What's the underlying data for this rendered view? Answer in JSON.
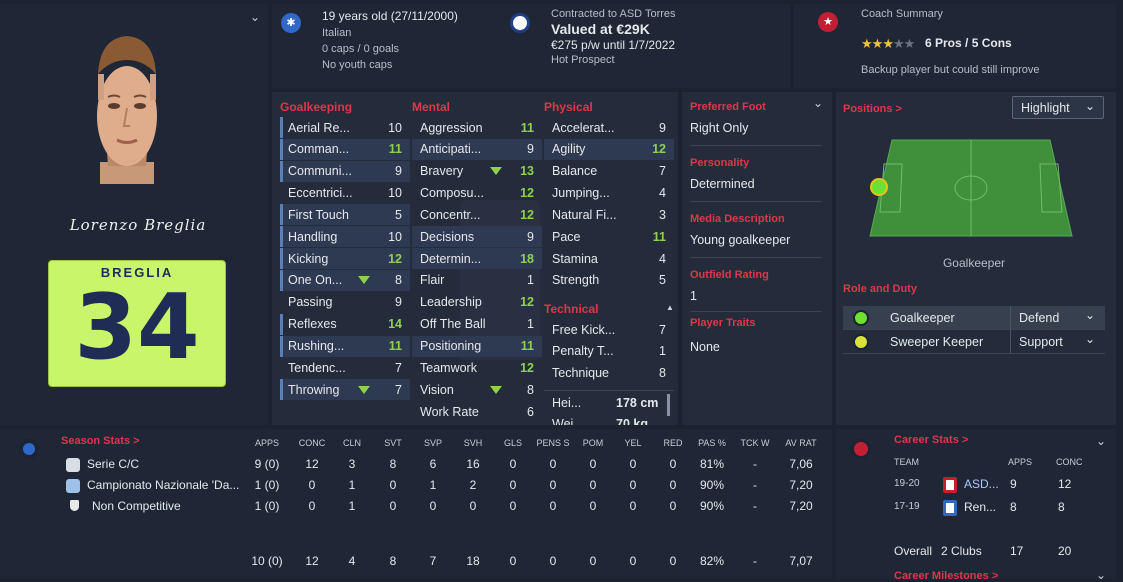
{
  "player": {
    "name_signature": "Lorenzo Breglia",
    "shirt_name": "BREGLIA",
    "shirt_number": "34",
    "age_line": "19 years old (27/11/2000)",
    "nationality": "Italian",
    "caps": "0 caps / 0 goals",
    "youth_caps": "No youth caps"
  },
  "contract": {
    "line1": "Contracted to ASD Torres",
    "value": "Valued at €29K",
    "wage": "€275 p/w until 1/7/2022",
    "tag": "Hot Prospect"
  },
  "coach": {
    "title": "Coach Summary",
    "stars_full": 3,
    "stars_total": 5,
    "pros_cons": "6 Pros / 5 Cons",
    "summary": "Backup player but could still improve"
  },
  "goalkeeping": {
    "header": "Goalkeeping",
    "items": [
      {
        "label": "Aerial Re...",
        "value": "10"
      },
      {
        "label": "Comman...",
        "value": "11"
      },
      {
        "label": "Communi...",
        "value": "9"
      },
      {
        "label": "Eccentrici...",
        "value": "10"
      },
      {
        "label": "First Touch",
        "value": "5"
      },
      {
        "label": "Handling",
        "value": "10"
      },
      {
        "label": "Kicking",
        "value": "12"
      },
      {
        "label": "One On...",
        "value": "8"
      },
      {
        "label": "Passing",
        "value": "9"
      },
      {
        "label": "Reflexes",
        "value": "14"
      },
      {
        "label": "Rushing...",
        "value": "11"
      },
      {
        "label": "Tendenc...",
        "value": "7"
      },
      {
        "label": "Throwing",
        "value": "7"
      }
    ]
  },
  "mental": {
    "header": "Mental",
    "items": [
      {
        "label": "Aggression",
        "value": "11"
      },
      {
        "label": "Anticipati...",
        "value": "9"
      },
      {
        "label": "Bravery",
        "value": "13"
      },
      {
        "label": "Composu...",
        "value": "12"
      },
      {
        "label": "Concentr...",
        "value": "12"
      },
      {
        "label": "Decisions",
        "value": "9"
      },
      {
        "label": "Determin...",
        "value": "18"
      },
      {
        "label": "Flair",
        "value": "1"
      },
      {
        "label": "Leadership",
        "value": "12"
      },
      {
        "label": "Off The Ball",
        "value": "1"
      },
      {
        "label": "Positioning",
        "value": "11"
      },
      {
        "label": "Teamwork",
        "value": "12"
      },
      {
        "label": "Vision",
        "value": "8"
      },
      {
        "label": "Work Rate",
        "value": "6"
      }
    ]
  },
  "physical": {
    "header": "Physical",
    "items": [
      {
        "label": "Accelerat...",
        "value": "9"
      },
      {
        "label": "Agility",
        "value": "12"
      },
      {
        "label": "Balance",
        "value": "7"
      },
      {
        "label": "Jumping...",
        "value": "4"
      },
      {
        "label": "Natural Fi...",
        "value": "3"
      },
      {
        "label": "Pace",
        "value": "11"
      },
      {
        "label": "Stamina",
        "value": "4"
      },
      {
        "label": "Strength",
        "value": "5"
      }
    ]
  },
  "technical": {
    "header": "Technical",
    "items": [
      {
        "label": "Free Kick...",
        "value": "7"
      },
      {
        "label": "Penalty T...",
        "value": "1"
      },
      {
        "label": "Technique",
        "value": "8"
      }
    ]
  },
  "physique": {
    "height_label": "Hei...",
    "height": "178 cm",
    "weight_label": "Wei...",
    "weight": "70 kg"
  },
  "info": {
    "foot_h": "Preferred Foot",
    "foot": "Right Only",
    "pers_h": "Personality",
    "pers": "Determined",
    "media_h": "Media Description",
    "media": "Young goalkeeper",
    "outfield_h": "Outfield Rating",
    "outfield": "1",
    "traits_h": "Player Traits",
    "traits": "None"
  },
  "positions": {
    "title": "Positions >",
    "highlight": "Highlight",
    "pitch_label": "Goalkeeper",
    "role_title": "Role and Duty",
    "roles": [
      {
        "role": "Goalkeeper",
        "duty": "Defend",
        "color": "#6fe031"
      },
      {
        "role": "Sweeper Keeper",
        "duty": "Support",
        "color": "#d8e23a"
      }
    ]
  },
  "season": {
    "title": "Season Stats >",
    "headers": [
      "APPS",
      "CONC",
      "CLN",
      "SVT",
      "SVP",
      "SVH",
      "GLS",
      "PENS S",
      "POM",
      "YEL",
      "RED",
      "PAS %",
      "TCK W",
      "AV RAT"
    ],
    "rows": [
      {
        "comp": "Serie C/C",
        "cells": [
          "9 (0)",
          "12",
          "3",
          "8",
          "6",
          "16",
          "0",
          "0",
          "0",
          "0",
          "0",
          "81%",
          "-",
          "7,06"
        ]
      },
      {
        "comp": "Campionato Nazionale 'Da...",
        "cells": [
          "1 (0)",
          "0",
          "1",
          "0",
          "1",
          "2",
          "0",
          "0",
          "0",
          "0",
          "0",
          "90%",
          "-",
          "7,20"
        ]
      },
      {
        "comp": "Non Competitive",
        "cells": [
          "1 (0)",
          "0",
          "1",
          "0",
          "0",
          "0",
          "0",
          "0",
          "0",
          "0",
          "0",
          "90%",
          "-",
          "7,20"
        ]
      }
    ],
    "totals": [
      "10 (0)",
      "12",
      "4",
      "8",
      "7",
      "18",
      "0",
      "0",
      "0",
      "0",
      "0",
      "82%",
      "-",
      "7,07"
    ]
  },
  "career": {
    "title": "Career Stats >",
    "headers": [
      "TEAM",
      "APPS",
      "CONC"
    ],
    "rows": [
      {
        "season": "19-20",
        "team": "ASD...",
        "apps": "9",
        "conc": "12"
      },
      {
        "season": "17-19",
        "team": "Ren...",
        "apps": "8",
        "conc": "8"
      }
    ],
    "overall_label": "Overall",
    "overall_clubs": "2 Clubs",
    "overall_apps": "17",
    "overall_conc": "20",
    "milestones": "Career Milestones >"
  },
  "colors": {
    "accent": "#e0364a",
    "good": "#8fd14f",
    "shirt": "#c8f56a",
    "panel": "#242c3b"
  }
}
